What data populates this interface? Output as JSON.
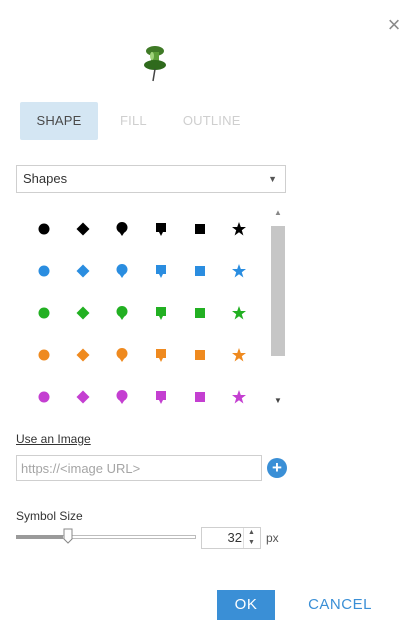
{
  "dialog": {
    "close_glyph": "×",
    "preview_icon": "green-pushpin-icon"
  },
  "tabs": [
    {
      "label": "SHAPE",
      "active": true
    },
    {
      "label": "FILL",
      "active": false
    },
    {
      "label": "OUTLINE",
      "active": false
    }
  ],
  "category_select": {
    "value": "Shapes",
    "caret_glyph": "▼"
  },
  "symbols": {
    "shapes": [
      "circle",
      "diamond",
      "pin",
      "callout",
      "square",
      "star"
    ],
    "colors": [
      "#000000",
      "#2a8de0",
      "#22b022",
      "#ef8a1f",
      "#c43fd1"
    ]
  },
  "scrollbar": {
    "up_glyph": "▲",
    "down_glyph": "▼"
  },
  "image": {
    "link_label": "Use an Image",
    "url_placeholder": "https://<image URL>",
    "url_value": "",
    "add_glyph": "+"
  },
  "symbol_size": {
    "label": "Symbol Size",
    "value": "32",
    "unit": "px",
    "slider_fraction": 0.29
  },
  "buttons": {
    "ok": "OK",
    "cancel": "CANCEL"
  }
}
